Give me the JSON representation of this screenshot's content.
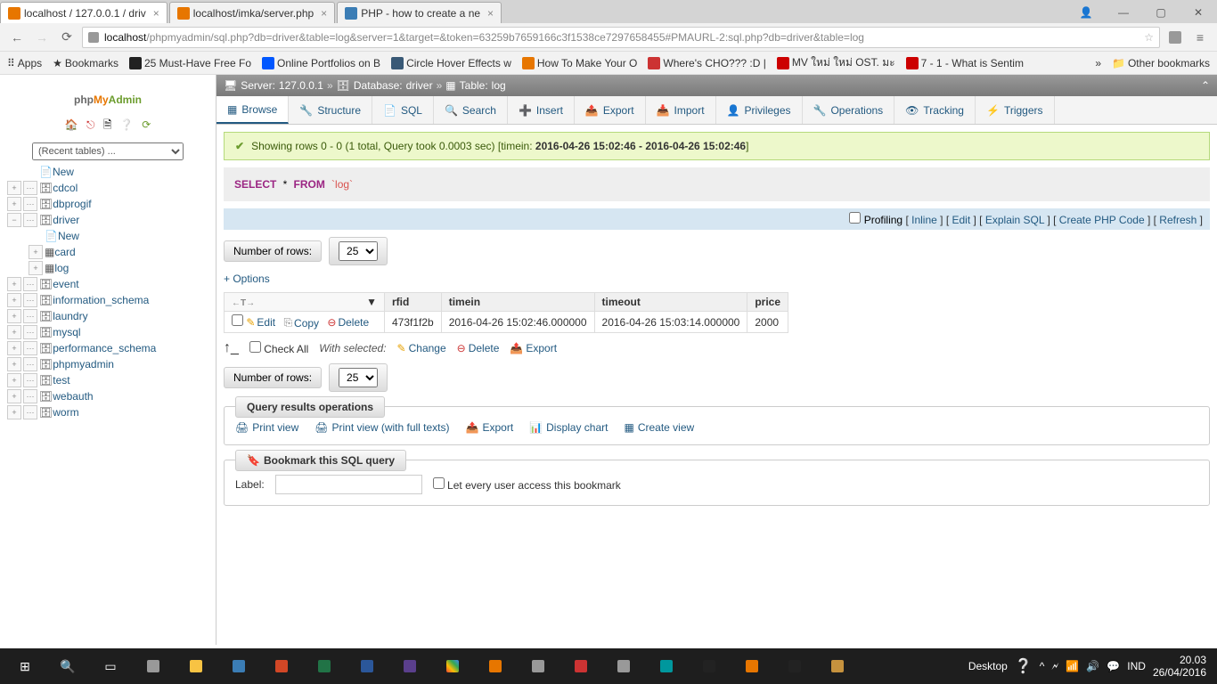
{
  "browser": {
    "tabs": [
      {
        "favicon": "pma",
        "title": "localhost / 127.0.0.1 / driv",
        "active": true
      },
      {
        "favicon": "xampp",
        "title": "localhost/imka/server.php",
        "active": false
      },
      {
        "favicon": "php",
        "title": "PHP - how to create a ne",
        "active": false
      }
    ],
    "url_host": "localhost",
    "url_path": "/phpmyadmin/sql.php?db=driver&table=log&server=1&target=&token=63259b7659166c3f1538ce7297658455#PMAURL-2:sql.php?db=driver&table=log"
  },
  "bookmarks": [
    {
      "icon": "apps",
      "label": "Apps"
    },
    {
      "icon": "star",
      "label": "Bookmarks"
    },
    {
      "icon": "E",
      "label": "25 Must-Have Free Fo"
    },
    {
      "icon": "be",
      "label": "Online Portfolios on B"
    },
    {
      "icon": "tumblr",
      "label": "Circle Hover Effects w"
    },
    {
      "icon": "howto",
      "label": "How To Make Your O"
    },
    {
      "icon": "cho",
      "label": "Where's CHO??? :D |"
    },
    {
      "icon": "yt",
      "label": "MV ใหม่ ใหม่ OST. มะ"
    },
    {
      "icon": "yt",
      "label": "7 - 1 - What is Sentim"
    }
  ],
  "other_bookmarks": "Other bookmarks",
  "sidebar": {
    "recent_label": "(Recent tables) ...",
    "tree": {
      "new": "New",
      "dbs": [
        "cdcol",
        "dbprogif"
      ],
      "driver": "driver",
      "driver_children": {
        "new": "New",
        "card": "card",
        "log": "log"
      },
      "dbs2": [
        "event",
        "information_schema",
        "laundry",
        "mysql",
        "performance_schema",
        "phpmyadmin",
        "test",
        "webauth",
        "worm"
      ]
    }
  },
  "breadcrumb": {
    "server_label": "Server:",
    "server": "127.0.0.1",
    "db_label": "Database:",
    "db": "driver",
    "table_label": "Table:",
    "table": "log"
  },
  "tabs": [
    "Browse",
    "Structure",
    "SQL",
    "Search",
    "Insert",
    "Export",
    "Import",
    "Privileges",
    "Operations",
    "Tracking",
    "Triggers"
  ],
  "success": {
    "prefix": "Showing rows 0 - 0 (1 total, Query took 0.0003 sec) [timein:",
    "time1": "2016-04-26 15:02:46",
    "dash": " - ",
    "time2": "2016-04-26 15:02:46",
    "suffix": "]"
  },
  "sql": {
    "select": "SELECT",
    "star": "*",
    "from": "FROM",
    "table": "`log`"
  },
  "profiling": {
    "profiling": "Profiling",
    "links": [
      "Inline",
      "Edit",
      "Explain SQL",
      "Create PHP Code",
      "Refresh"
    ]
  },
  "rows": {
    "label": "Number of rows:",
    "value": "25"
  },
  "options_link": "+ Options",
  "table": {
    "headers": [
      "rfid",
      "timein",
      "timeout",
      "price"
    ],
    "row": {
      "edit": "Edit",
      "copy": "Copy",
      "delete": "Delete",
      "rfid": "473f1f2b",
      "timein": "2016-04-26 15:02:46.000000",
      "timeout": "2016-04-26 15:03:14.000000",
      "price": "2000"
    }
  },
  "check": {
    "check_all": "Check All",
    "with_selected": "With selected:",
    "change": "Change",
    "delete": "Delete",
    "export": "Export"
  },
  "ops_legend": "Query results operations",
  "ops": [
    "Print view",
    "Print view (with full texts)",
    "Export",
    "Display chart",
    "Create view"
  ],
  "bookmark": {
    "legend": "Bookmark this SQL query",
    "label": "Label:",
    "checkbox": "Let every user access this bookmark"
  },
  "taskbar": {
    "desktop": "Desktop",
    "lang": "IND",
    "time": "20.03",
    "date": "26/04/2016"
  }
}
